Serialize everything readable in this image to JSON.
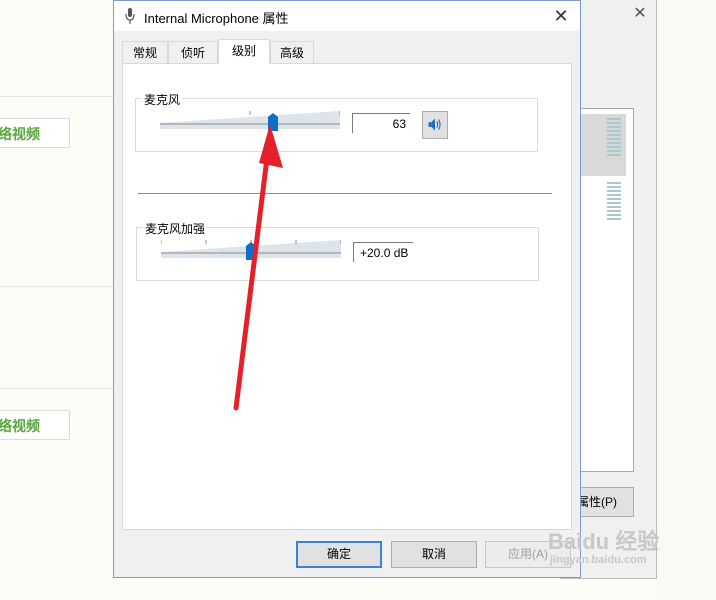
{
  "background_page": {
    "link_text": "络视频"
  },
  "background_dialog": {
    "close_glyph": "✕",
    "properties_button": "属性(P)"
  },
  "dialog": {
    "title": "Internal Microphone 属性",
    "close_glyph": "✕",
    "tabs": [
      {
        "label": "常规"
      },
      {
        "label": "侦听"
      },
      {
        "label": "级别",
        "active": true
      },
      {
        "label": "高级"
      }
    ],
    "microphone": {
      "label": "麦克风",
      "level": 63,
      "value_text": "63"
    },
    "boost": {
      "label": "麦克风加强",
      "level_fraction": 0.5,
      "value_text": "+20.0 dB"
    },
    "buttons": {
      "ok": "确定",
      "cancel": "取消",
      "apply": "应用(A)"
    }
  },
  "watermark": {
    "brand": "Baidu 经验",
    "url": "jingyan.baidu.com"
  },
  "colors": {
    "accent": "#0078d7",
    "arrow": "#e5202a",
    "link_green": "#5aa63c"
  }
}
